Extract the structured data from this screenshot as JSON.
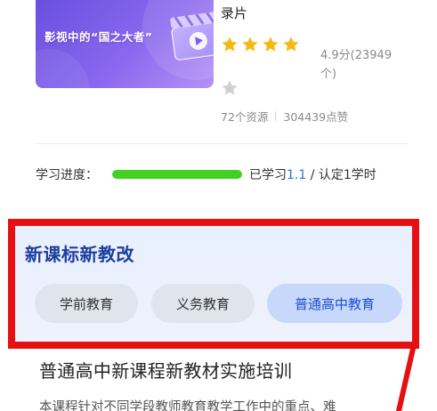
{
  "course": {
    "cover_text": "影视中的“国之大者”",
    "title_tail": "录片",
    "rating_text": "4.9分(23949个)",
    "stars_filled": 4,
    "stars_total": 5,
    "resources": "72个资源",
    "likes": "304439点赞"
  },
  "progress": {
    "label": "学习进度：",
    "fraction": 1.0,
    "prefix": "已学习",
    "value": "1.1",
    "suffix": " / 认定1学时"
  },
  "section": {
    "title": "新课标新教改",
    "tabs": [
      {
        "label": "学前教育",
        "active": false
      },
      {
        "label": "义务教育",
        "active": false
      },
      {
        "label": "普通高中教育",
        "active": true
      }
    ]
  },
  "training": {
    "title": "普通高中新课程新教材实施培训",
    "description": "本课程针对不同学段教师教育教学工作中的重点、难"
  },
  "colors": {
    "accent": "#2f6fe0",
    "progress": "#42d021",
    "highlight_border": "#e60f12",
    "section_title": "#1d3f9c"
  }
}
